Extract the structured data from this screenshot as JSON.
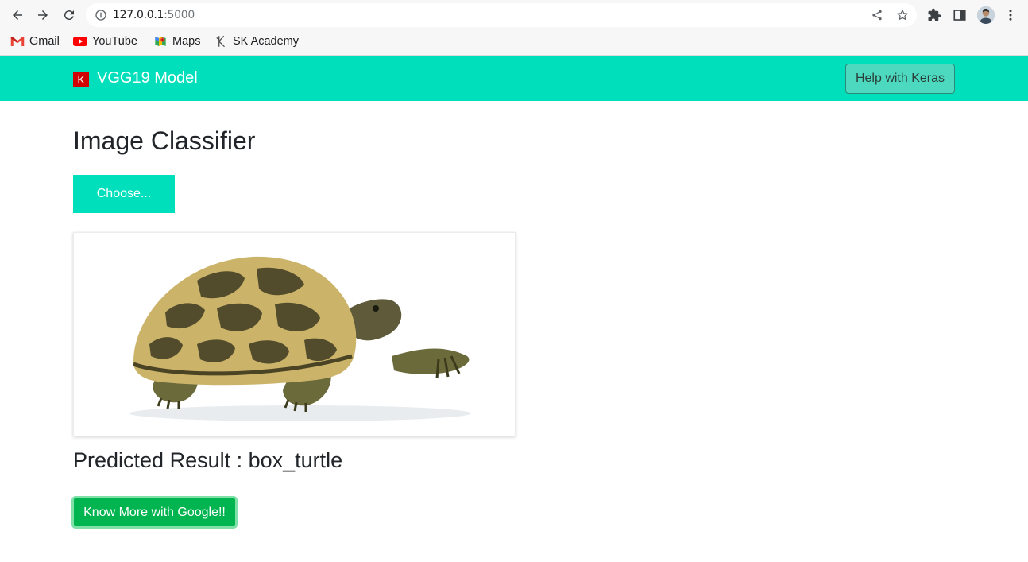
{
  "browser": {
    "url_host": "127.0.0.1",
    "url_port": ":5000",
    "bookmarks": [
      {
        "label": "Gmail",
        "icon": "gmail-icon"
      },
      {
        "label": "YouTube",
        "icon": "youtube-icon"
      },
      {
        "label": "Maps",
        "icon": "maps-icon"
      },
      {
        "label": "SK Academy",
        "icon": "sk-academy-icon"
      }
    ]
  },
  "navbar": {
    "brand_icon_letter": "K",
    "brand": "VGG19 Model",
    "help_button": "Help with Keras",
    "background_color": "#00dfbc"
  },
  "main": {
    "title": "Image Classifier",
    "choose_button": "Choose...",
    "image_subject": "turtle-image",
    "result_text": "Predicted Result : box_turtle",
    "google_button": "Know More with Google!!"
  },
  "colors": {
    "accent": "#00dfbc",
    "google_button": "#00b44f",
    "keras_red": "#d00000"
  }
}
